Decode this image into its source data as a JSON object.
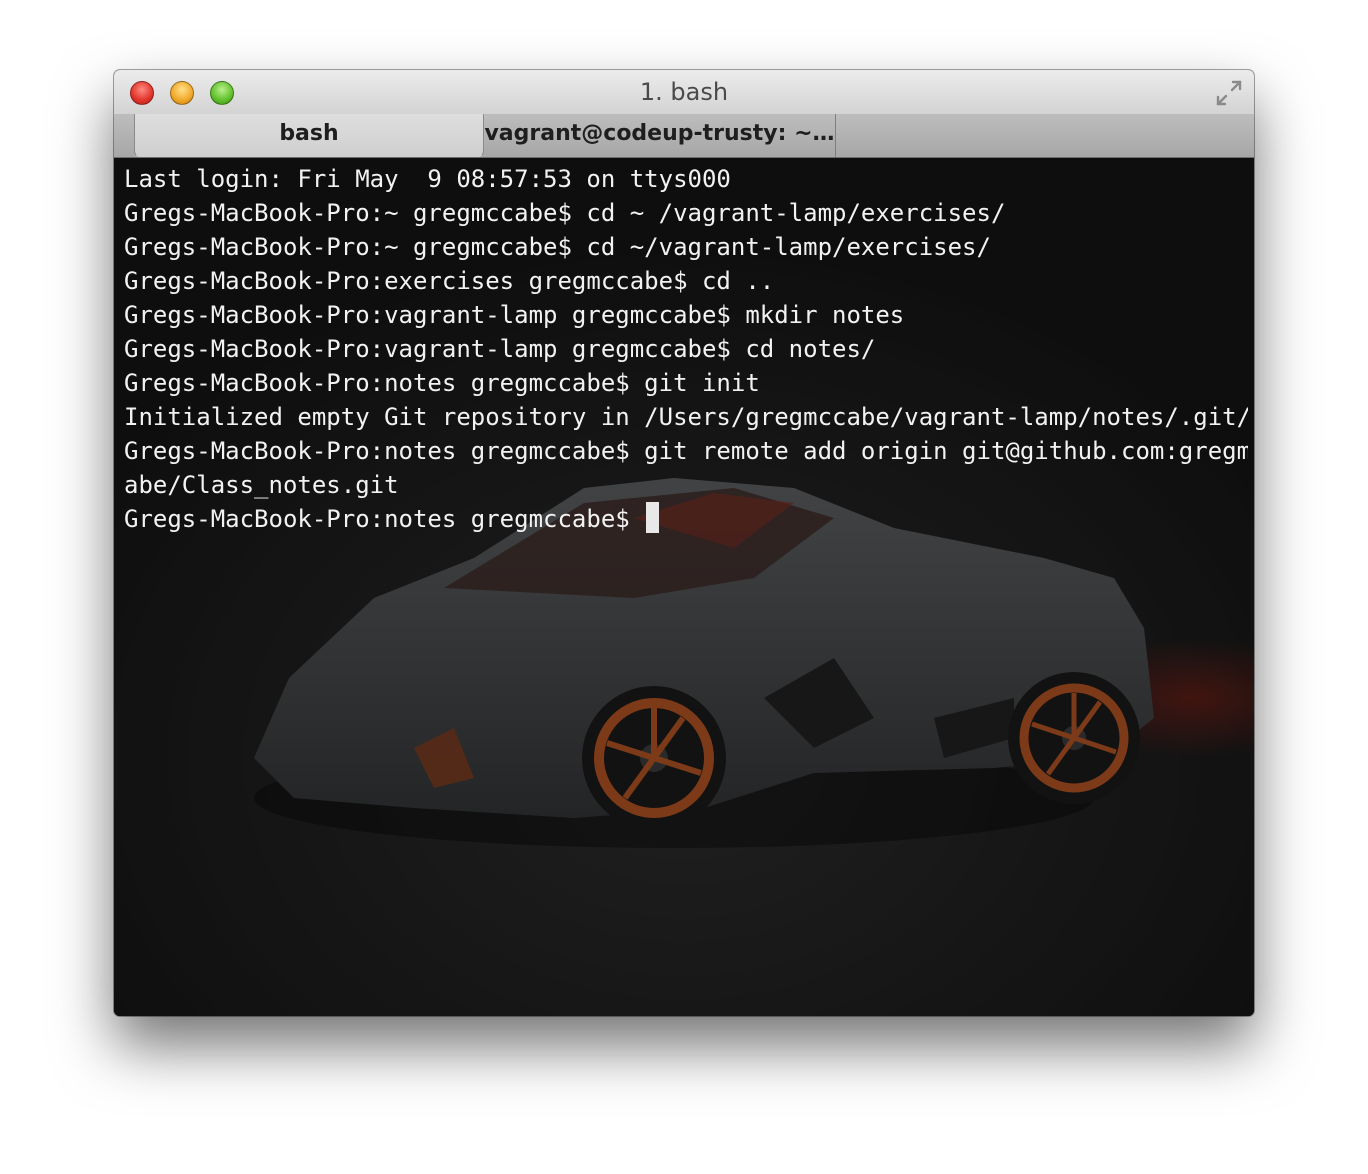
{
  "window": {
    "title": "1. bash"
  },
  "tabs": [
    {
      "label": "bash",
      "active": true
    },
    {
      "label": "vagrant@codeup-trusty: ~…",
      "active": false
    }
  ],
  "terminal": {
    "lines": [
      "Last login: Fri May  9 08:57:53 on ttys000",
      "Gregs-MacBook-Pro:~ gregmccabe$ cd ~ /vagrant-lamp/exercises/",
      "Gregs-MacBook-Pro:~ gregmccabe$ cd ~/vagrant-lamp/exercises/",
      "Gregs-MacBook-Pro:exercises gregmccabe$ cd ..",
      "Gregs-MacBook-Pro:vagrant-lamp gregmccabe$ mkdir notes",
      "Gregs-MacBook-Pro:vagrant-lamp gregmccabe$ cd notes/",
      "Gregs-MacBook-Pro:notes gregmccabe$ git init",
      "Initialized empty Git repository in /Users/gregmccabe/vagrant-lamp/notes/.git/",
      "Gregs-MacBook-Pro:notes gregmccabe$ git remote add origin git@github.com:gregmcc",
      "abe/Class_notes.git"
    ],
    "prompt": "Gregs-MacBook-Pro:notes gregmccabe$ ",
    "background": "supercar-wallpaper"
  },
  "colors": {
    "terminal_bg": "#0f0f0f",
    "terminal_fg": "#f2f2f2",
    "accent_orange": "#d2551f"
  },
  "icons": {
    "close": "close-icon",
    "minimize": "minimize-icon",
    "zoom": "zoom-icon",
    "fullscreen": "fullscreen-icon"
  }
}
